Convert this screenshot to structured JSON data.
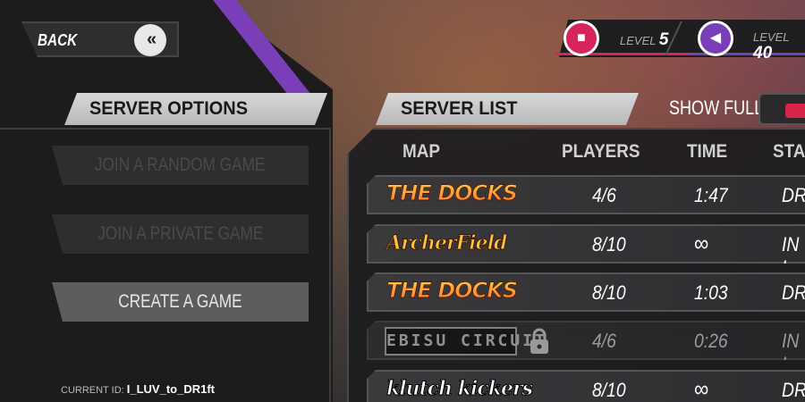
{
  "nav": {
    "back_label": "BACK",
    "back_icon": "chevrons-left-icon"
  },
  "levels": [
    {
      "icon": "car-icon",
      "label": "LEVEL",
      "value": "5",
      "color": "#d8245c"
    },
    {
      "icon": "tag-icon",
      "label": "LEVEL",
      "value": "40",
      "color": "#7a3fb8"
    }
  ],
  "options": {
    "title": "SERVER OPTIONS",
    "buttons": [
      {
        "label": "JOIN A RANDOM GAME",
        "enabled": false
      },
      {
        "label": "JOIN A PRIVATE GAME",
        "enabled": false
      },
      {
        "label": "CREATE A GAME",
        "enabled": true
      }
    ],
    "current_id_label": "CURRENT ID:",
    "current_id_value": "I_LUV_to_DR1ft"
  },
  "server_list": {
    "title": "SERVER LIST",
    "show_full_label": "SHOW FULL",
    "columns": [
      "MAP",
      "PLAYERS",
      "TIME",
      "STA"
    ],
    "rows": [
      {
        "map": "THE DOCKS",
        "players": "4/6",
        "time": "1:47",
        "status": "DRI",
        "locked": false
      },
      {
        "map": "ArcherField",
        "players": "8/10",
        "time": "∞",
        "status": "IN L",
        "locked": false
      },
      {
        "map": "THE DOCKS",
        "players": "8/10",
        "time": "1:03",
        "status": "DRI",
        "locked": false
      },
      {
        "map": "EBISU CIRCUIT",
        "players": "4/6",
        "time": "0:26",
        "status": "IN L",
        "locked": true
      },
      {
        "map": "klutch kickers",
        "players": "8/10",
        "time": "∞",
        "status": "DRI",
        "locked": false
      }
    ]
  },
  "colors": {
    "accent_pink": "#d8245c",
    "accent_purple": "#7a3fb8",
    "toggle_red": "#d8244a"
  }
}
